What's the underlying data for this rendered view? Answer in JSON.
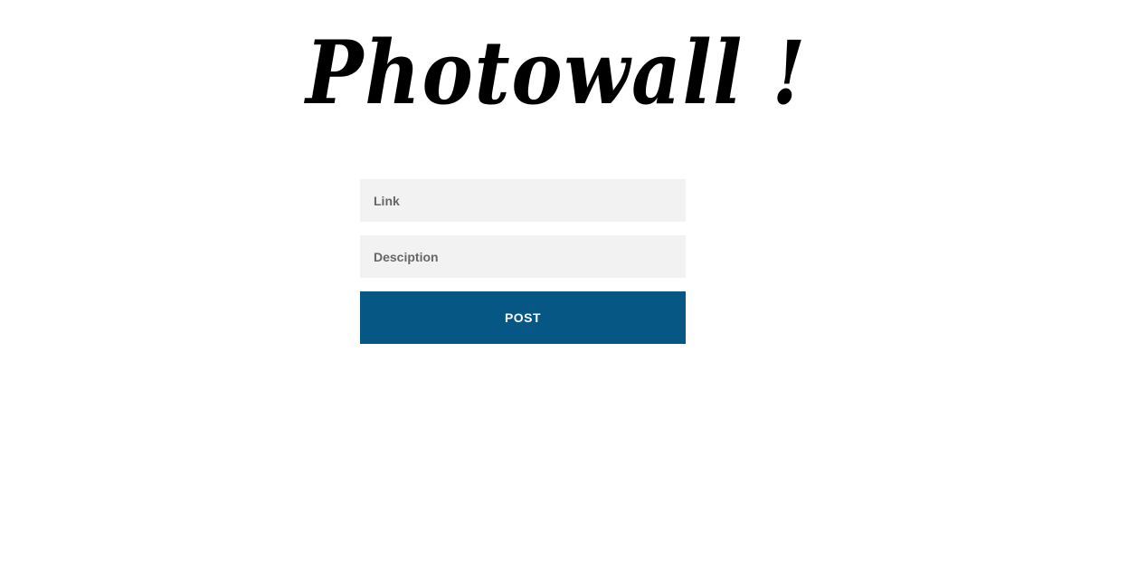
{
  "header": {
    "title": "Photowall !"
  },
  "form": {
    "link_field": {
      "placeholder": "Link",
      "value": ""
    },
    "description_field": {
      "placeholder": "Desciption",
      "value": ""
    },
    "submit_label": "POST",
    "submit_color": "#065784",
    "field_background": "#f2f2f2"
  }
}
